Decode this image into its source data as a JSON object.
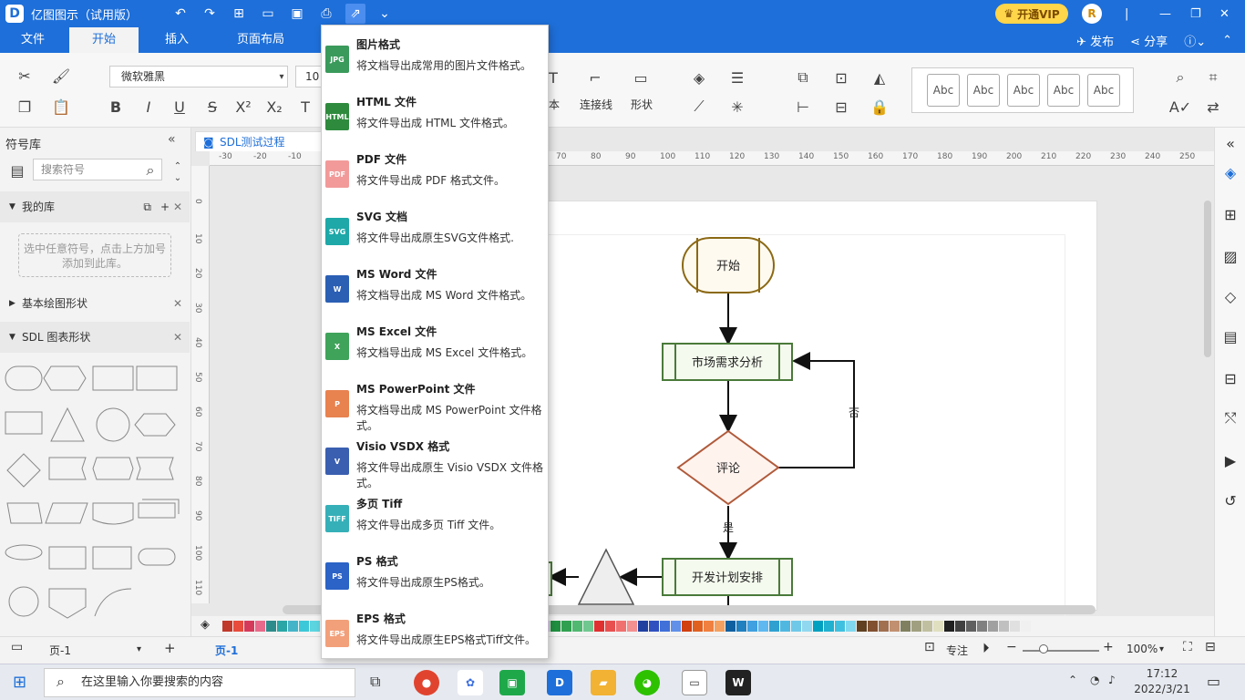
{
  "titlebar": {
    "logo": "D",
    "title": "亿图图示（试用版）",
    "vip_label": "开通VIP",
    "avatar_letter": "R"
  },
  "menu_tabs": [
    "文件",
    "开始",
    "插入",
    "页面布局"
  ],
  "menu_right": {
    "publish": "发布",
    "share": "分享"
  },
  "ribbon": {
    "font_name": "微软雅黑",
    "font_size": "10",
    "text_label": "本",
    "connector_label": "连接线",
    "shape_label": "形状",
    "style_samples": [
      "Abc",
      "Abc",
      "Abc",
      "Abc",
      "Abc"
    ]
  },
  "left_panel": {
    "title": "符号库",
    "search_placeholder": "搜索符号",
    "my_library": "我的库",
    "hint": "选中任意符号，点击上方加号添加到此库。",
    "basic_shapes": "基本绘图形状",
    "sdl_shapes": "SDL 图表形状"
  },
  "document": {
    "tab_name": "SDL测试过程",
    "ruler_top": [
      "-30",
      "-20",
      "-10",
      "0",
      "70",
      "80",
      "90",
      "100",
      "110",
      "120",
      "130",
      "140",
      "150",
      "160",
      "170",
      "180",
      "190",
      "200",
      "210",
      "220",
      "230",
      "240",
      "250"
    ],
    "ruler_left": [
      "0",
      "10",
      "20",
      "30",
      "40",
      "50",
      "60",
      "70",
      "80",
      "90",
      "100",
      "110"
    ]
  },
  "flowchart": {
    "start": "开始",
    "analysis": "市场需求分析",
    "review": "评论",
    "plan": "开发计划安排",
    "no_label": "否",
    "yes_label": "是"
  },
  "export_menu": [
    {
      "icon": "JPG",
      "color": "#3a9a5b",
      "title": "图片格式",
      "desc": "将文档导出成常用的图片文件格式。"
    },
    {
      "icon": "HTML",
      "color": "#2e8b3e",
      "title": "HTML 文件",
      "desc": "将文件导出成 HTML 文件格式。"
    },
    {
      "icon": "PDF",
      "color": "#f29a9a",
      "title": "PDF 文件",
      "desc": "将文件导出成 PDF 格式文件。"
    },
    {
      "icon": "SVG",
      "color": "#1ea8a8",
      "title": "SVG 文档",
      "desc": "将文件导出成原生SVG文件格式."
    },
    {
      "icon": "W",
      "color": "#2b5fb4",
      "title": "MS Word 文件",
      "desc": "将文档导出成 MS Word 文件格式。"
    },
    {
      "icon": "X",
      "color": "#3fa35a",
      "title": "MS Excel 文件",
      "desc": "将文档导出成 MS Excel 文件格式。"
    },
    {
      "icon": "P",
      "color": "#e8824f",
      "title": "MS PowerPoint 文件",
      "desc": "将文档导出成 MS PowerPoint 文件格式。"
    },
    {
      "icon": "V",
      "color": "#3a5fb0",
      "title": "Visio VSDX 格式",
      "desc": "将文件导出成原生 Visio VSDX 文件格式。"
    },
    {
      "icon": "TIFF",
      "color": "#36b0b8",
      "title": "多页 Tiff",
      "desc": "将文件导出成多页 Tiff 文件。"
    },
    {
      "icon": "PS",
      "color": "#2b63c6",
      "title": "PS 格式",
      "desc": "将文件导出成原生PS格式。"
    },
    {
      "icon": "EPS",
      "color": "#f2a07a",
      "title": "EPS 格式",
      "desc": "将文件导出成原生EPS格式Tiff文件。"
    }
  ],
  "statusbar": {
    "page_select": "页-1",
    "page_tab": "页-1",
    "focus": "专注",
    "zoom": "100%"
  },
  "taskbar": {
    "search_placeholder": "在这里输入你要搜索的内容",
    "time": "17:12",
    "date": "2022/3/21"
  },
  "colors": {
    "accent": "#1e6fd9",
    "start_stroke": "#8b6914",
    "process_stroke": "#4a7a3a",
    "decision_stroke": "#b05a3a"
  }
}
